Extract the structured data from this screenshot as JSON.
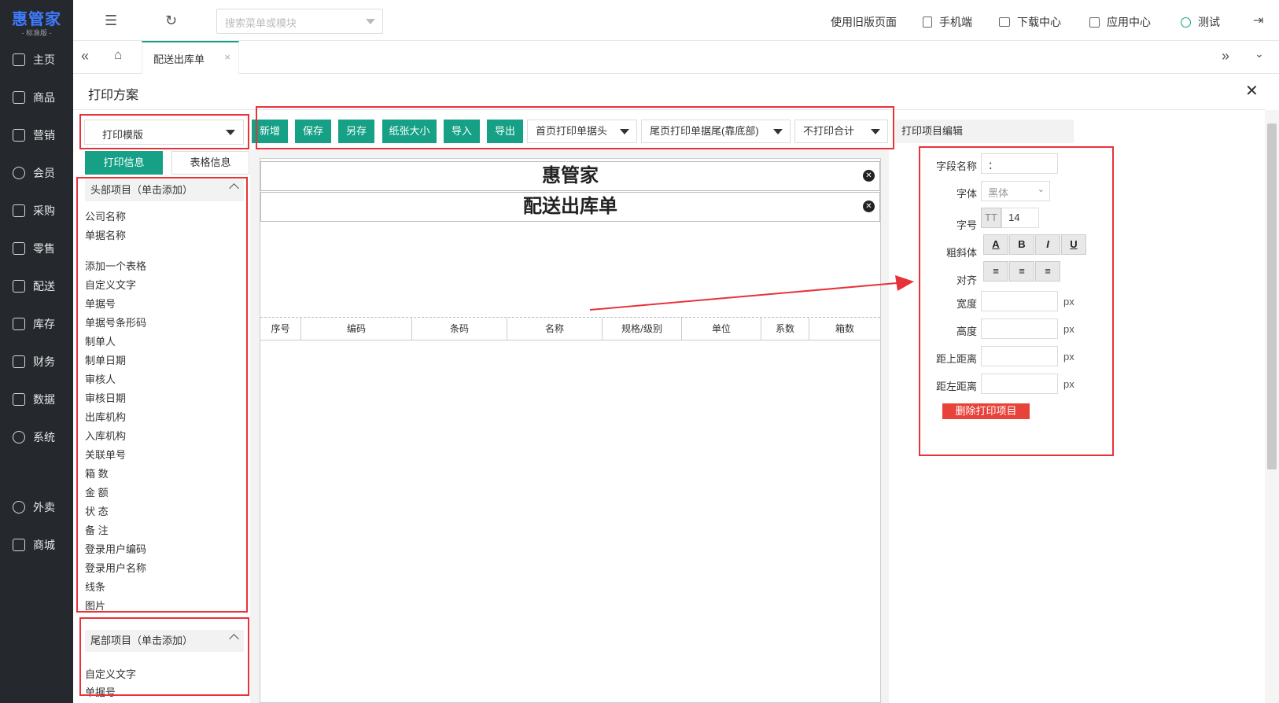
{
  "sidebar": {
    "brand": "惠管家",
    "edition": "- 标准版 -",
    "items": [
      {
        "label": "主页",
        "icon": "home-icon"
      },
      {
        "label": "商品",
        "icon": "cube-icon"
      },
      {
        "label": "营销",
        "icon": "chart-line-icon"
      },
      {
        "label": "会员",
        "icon": "diamond-icon"
      },
      {
        "label": "采购",
        "icon": "cart-icon"
      },
      {
        "label": "零售",
        "icon": "bag-icon"
      },
      {
        "label": "配送",
        "icon": "truck-icon"
      },
      {
        "label": "库存",
        "icon": "box-icon"
      },
      {
        "label": "财务",
        "icon": "yen-icon"
      },
      {
        "label": "数据",
        "icon": "bar-chart-icon"
      },
      {
        "label": "系统",
        "icon": "gear-icon"
      },
      {
        "label": "外卖",
        "icon": "bike-icon"
      },
      {
        "label": "商城",
        "icon": "store-icon"
      }
    ]
  },
  "topbar": {
    "search_placeholder": "搜索菜单或模块",
    "links": [
      {
        "label": "使用旧版页面"
      },
      {
        "label": "手机端"
      },
      {
        "label": "下载中心"
      },
      {
        "label": "应用中心"
      },
      {
        "label": "测试"
      }
    ]
  },
  "tabs": {
    "active": "配送出库单",
    "close": "×"
  },
  "panel": {
    "title": "打印方案",
    "close": "✕"
  },
  "left": {
    "template_select": "打印模版",
    "tab_info": "打印信息",
    "tab_table": "表格信息",
    "header_group": "头部项目（单击添加）",
    "header_items": [
      "公司名称",
      "单据名称",
      "",
      "添加一个表格",
      "自定义文字",
      "单据号",
      "单据号条形码",
      "制单人",
      "制单日期",
      "审核人",
      "审核日期",
      "出库机构",
      "入库机构",
      "关联单号",
      "箱 数",
      "金 额",
      "状 态",
      "备 注",
      "登录用户编码",
      "登录用户名称",
      "线条",
      "图片"
    ],
    "footer_group": "尾部项目（单击添加）",
    "footer_items": [
      "自定义文字",
      "单据号"
    ]
  },
  "toolbar": {
    "new": "新增",
    "save": "保存",
    "save_as": "另存",
    "paper": "纸张大小",
    "import": "导入",
    "export": "导出",
    "first_page_header": "首页打印单据头",
    "last_page_footer": "尾页打印单据尾(靠底部)",
    "total": "不打印合计"
  },
  "canvas": {
    "company": "惠管家",
    "doc_name": "配送出库单",
    "columns": [
      "序号",
      "编码",
      "条码",
      "名称",
      "规格/级别",
      "单位",
      "系数",
      "箱数"
    ]
  },
  "props": {
    "title": "打印项目编辑",
    "field_name_label": "字段名称",
    "field_name_value": "：",
    "font_label": "字体",
    "font_value": "黑体",
    "size_label": "字号",
    "size_value": "14",
    "size_icon": "TT",
    "style_label": "粗斜体",
    "style_buttons": [
      "A",
      "B",
      "I",
      "U"
    ],
    "align_label": "对齐",
    "width_label": "宽度",
    "height_label": "高度",
    "top_label": "距上距离",
    "left_label": "距左距离",
    "unit": "px",
    "delete": "删除打印项目"
  }
}
